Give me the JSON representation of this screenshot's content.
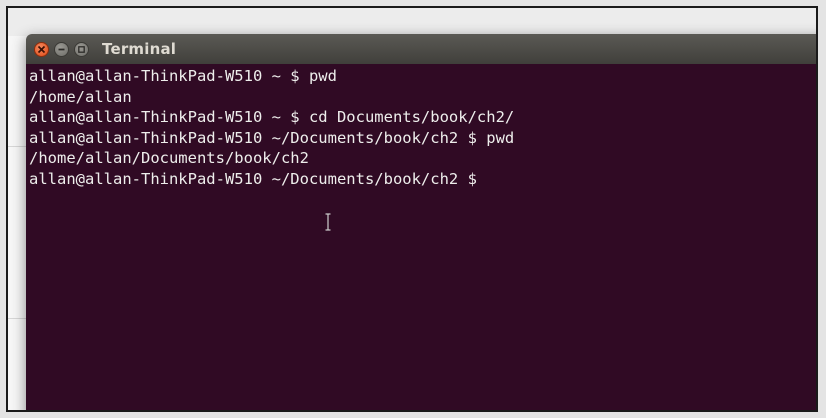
{
  "window": {
    "title": "Terminal"
  },
  "icons": {
    "close": "close-icon",
    "minimize": "minimize-icon",
    "maximize": "maximize-icon",
    "cursor": "text-cursor-icon"
  },
  "colors": {
    "terminal_background": "#300a24",
    "terminal_text": "#eeeeec",
    "titlebar": "#4b4a46",
    "close_button": "#e9541f"
  },
  "terminal": {
    "lines": [
      "allan@allan-ThinkPad-W510 ~ $ pwd",
      "/home/allan",
      "allan@allan-ThinkPad-W510 ~ $ cd Documents/book/ch2/",
      "allan@allan-ThinkPad-W510 ~/Documents/book/ch2 $ pwd",
      "/home/allan/Documents/book/ch2",
      "allan@allan-ThinkPad-W510 ~/Documents/book/ch2 $ "
    ]
  }
}
